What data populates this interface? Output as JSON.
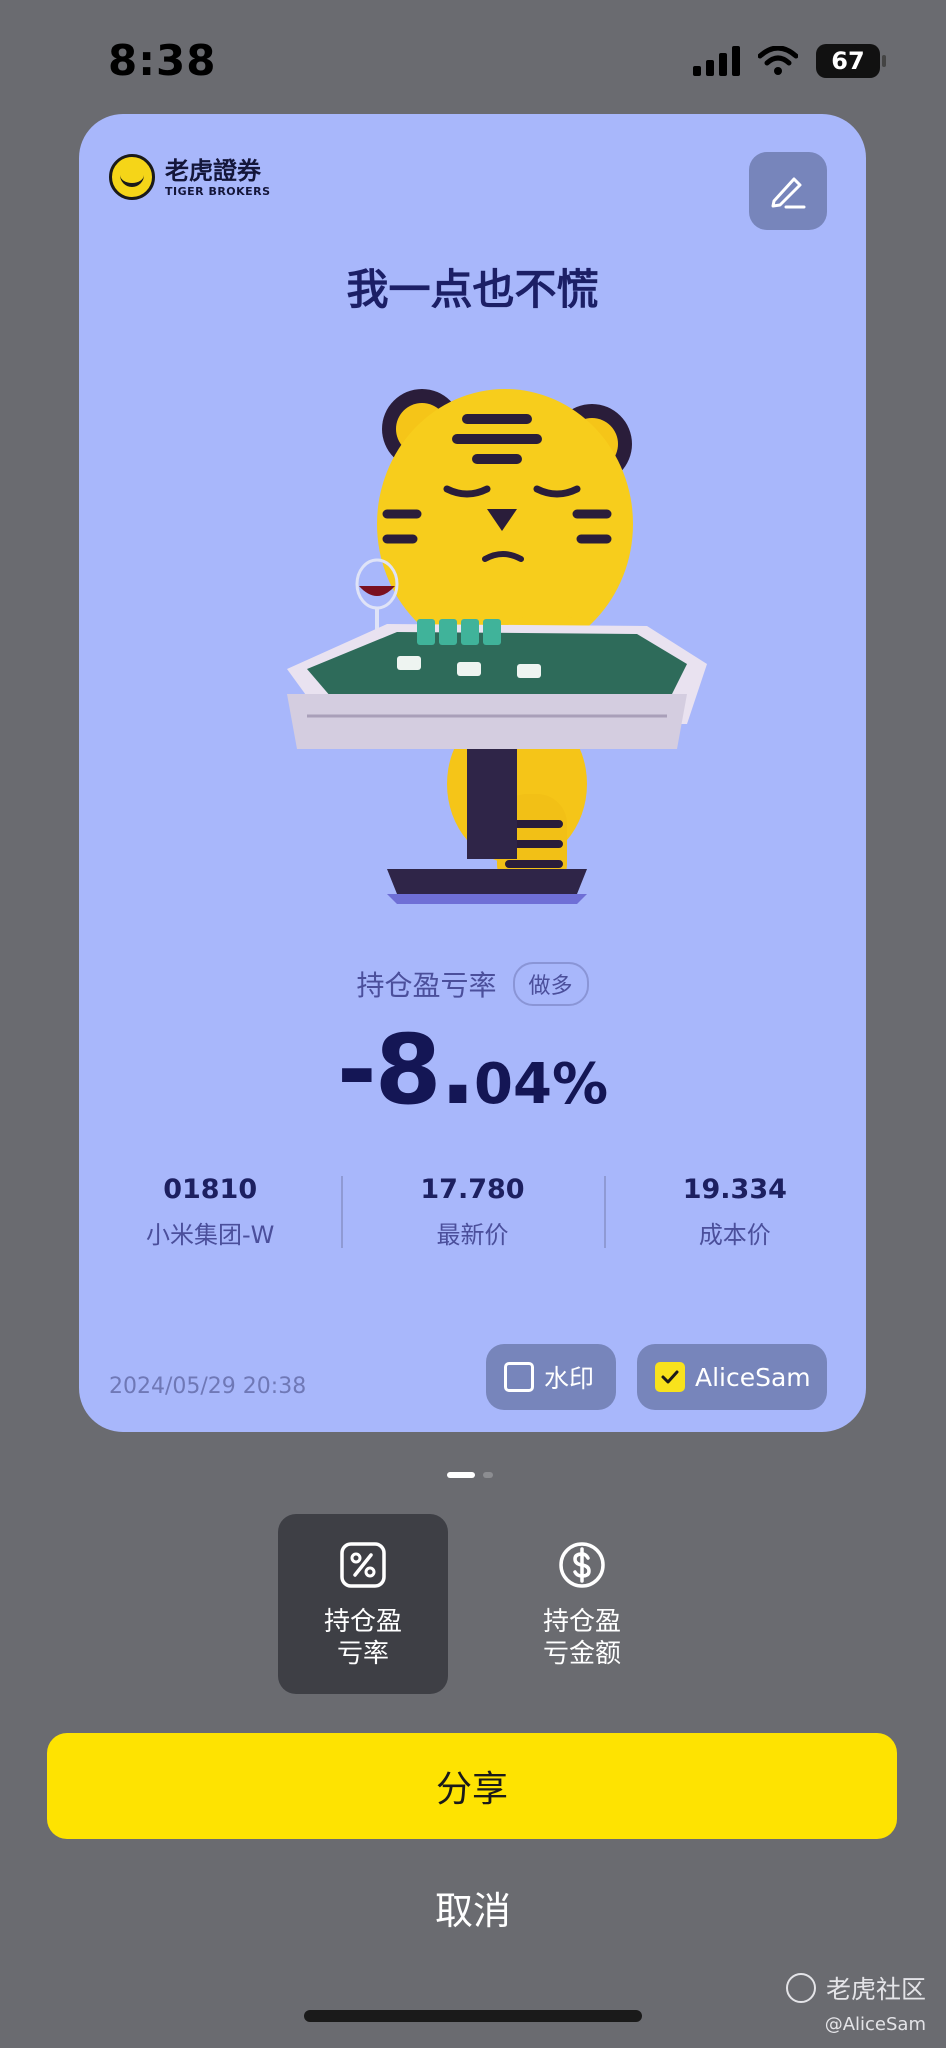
{
  "status_bar": {
    "time": "8:38",
    "battery": "67"
  },
  "card": {
    "brand_cn": "老虎證券",
    "brand_en": "TIGER BROKERS",
    "title": "我一点也不慌",
    "metric_label": "持仓盈亏率",
    "metric_tag": "做多",
    "metric_value_int": "-8.",
    "metric_value_dec": "04%",
    "stats": [
      {
        "value": "01810",
        "label": "小米集团-W"
      },
      {
        "value": "17.780",
        "label": "最新价"
      },
      {
        "value": "19.334",
        "label": "成本价"
      }
    ],
    "timestamp": "2024/05/29 20:38",
    "watermark_toggle": {
      "label": "水印",
      "checked": false
    },
    "user_toggle": {
      "label": "AliceSam",
      "checked": true
    }
  },
  "pager": {
    "pages": 2,
    "active": 0
  },
  "tabs": [
    {
      "label": "持仓盈\n亏率",
      "icon": "percent-icon",
      "active": true
    },
    {
      "label": "持仓盈\n亏金额",
      "icon": "dollar-icon",
      "active": false
    }
  ],
  "buttons": {
    "share": "分享",
    "cancel": "取消"
  },
  "watermark": {
    "community": "老虎社区",
    "handle": "@AliceSam"
  },
  "colors": {
    "card": "#a8b7fb",
    "accent": "#fee301",
    "background": "#6a6b70"
  }
}
